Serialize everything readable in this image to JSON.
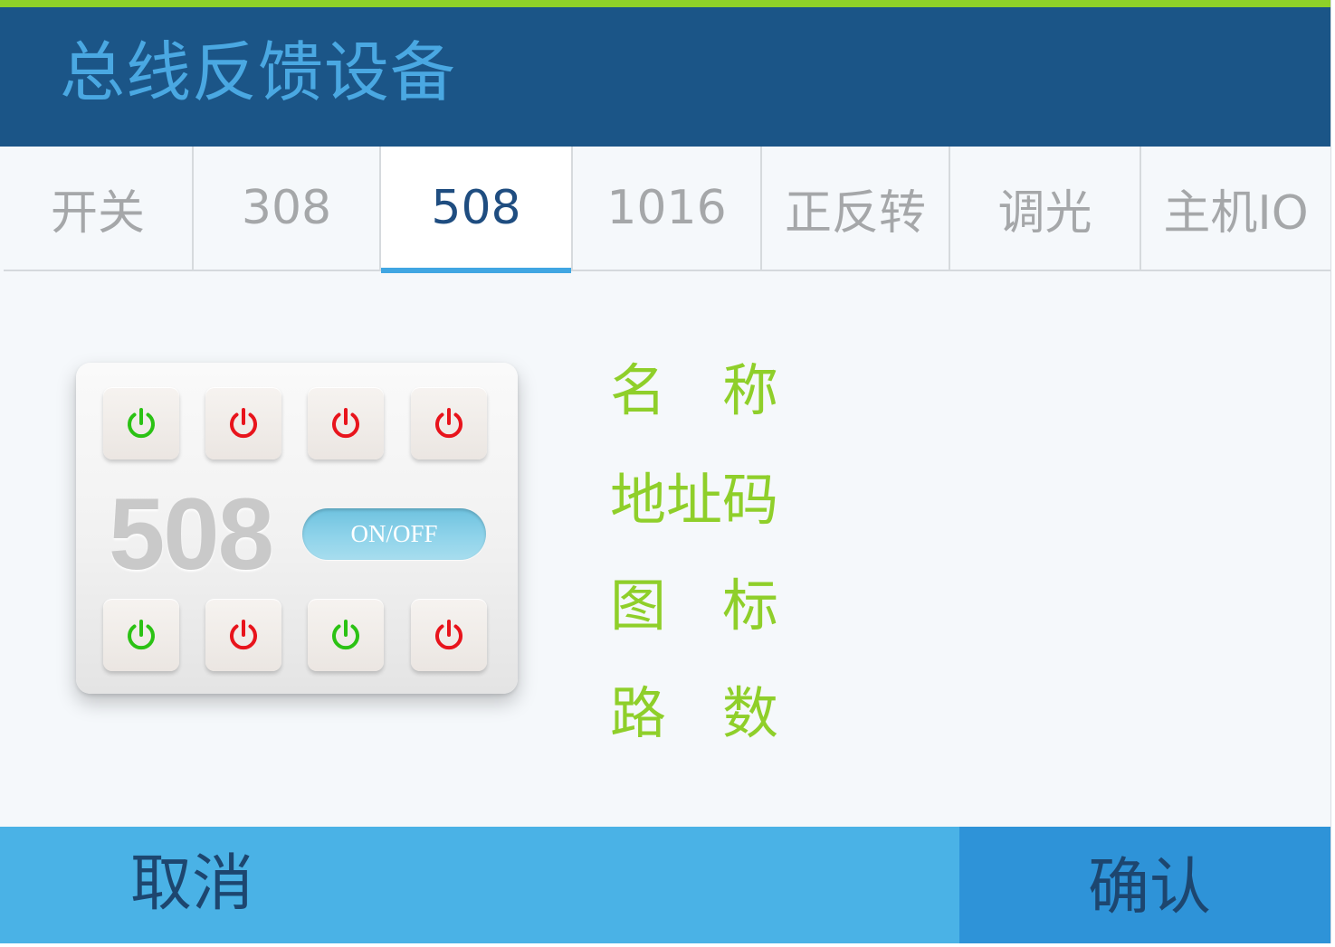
{
  "header": {
    "title": "总线反馈设备"
  },
  "tabs": [
    {
      "label": "开关",
      "active": false
    },
    {
      "label": "308",
      "active": false
    },
    {
      "label": "508",
      "active": true
    },
    {
      "label": "1016",
      "active": false
    },
    {
      "label": "正反转",
      "active": false
    },
    {
      "label": "调光",
      "active": false
    },
    {
      "label": "主机IO",
      "active": false
    }
  ],
  "device": {
    "model": "508",
    "toggle_label": "ON/OFF",
    "top_channels": [
      "on",
      "off",
      "off",
      "off"
    ],
    "bottom_channels": [
      "on",
      "off",
      "on",
      "off"
    ]
  },
  "form": {
    "name_label": "名　称",
    "address_label": "地址码",
    "icon_label": "图　标",
    "channels_label": "路　数"
  },
  "footer": {
    "cancel_label": "取消",
    "confirm_label": "确认"
  },
  "colors": {
    "header_bg": "#1b5587",
    "header_text": "#4aa8e2",
    "accent_green": "#8fd129",
    "label_green": "#8fcf2a",
    "active_tab_text": "#1f4d80",
    "tab_indicator": "#40a6e2",
    "power_on": "#2bc214",
    "power_off": "#e8141c",
    "footer_bg": "#4ab2e6",
    "confirm_bg": "#2e93d8"
  }
}
